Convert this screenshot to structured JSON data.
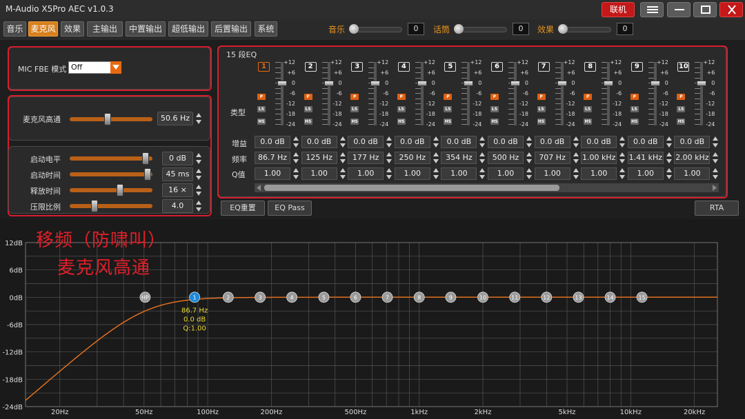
{
  "app": {
    "title": "M-Audio X5Pro AEC  v1.0.3",
    "link_label": "联机"
  },
  "menu": {
    "tabs": [
      {
        "label": "音乐",
        "active": false
      },
      {
        "label": "麦克风",
        "active": true
      },
      {
        "label": "效果",
        "active": false
      },
      {
        "label": "主输出",
        "active": false
      },
      {
        "label": "中置输出",
        "active": false
      },
      {
        "label": "超低输出",
        "active": false
      },
      {
        "label": "后置输出",
        "active": false
      },
      {
        "label": "系统",
        "active": false
      }
    ],
    "mixers": [
      {
        "label": "音乐",
        "value": "0",
        "level": 0
      },
      {
        "label": "话筒",
        "value": "0",
        "level": 0
      },
      {
        "label": "效果",
        "value": "0",
        "level": 0
      }
    ]
  },
  "fbe": {
    "label": "MIC FBE 模式",
    "value": "Off"
  },
  "highpass": {
    "label": "麦克风高通",
    "value": "50.6 Hz",
    "level": 0.45
  },
  "compressor": {
    "rows": [
      {
        "label": "启动电平",
        "value": "0 dB",
        "level": 0.95
      },
      {
        "label": "启动时间",
        "value": "45 ms",
        "level": 0.98
      },
      {
        "label": "释放时间",
        "value": "16 ×",
        "level": 0.62
      },
      {
        "label": "压限比例",
        "value": "4.0",
        "level": 0.28
      }
    ]
  },
  "eq": {
    "title": "15 段EQ",
    "scale_labels": [
      "+12",
      "+6",
      "0",
      "-6",
      "-12",
      "-18",
      "-24"
    ],
    "type_label": "类型",
    "type_buttons": [
      "P",
      "LS",
      "HS"
    ],
    "gain_label": "增益",
    "freq_label": "频率",
    "q_label": "Q值",
    "bands": [
      {
        "num": "1",
        "gain": "0.0 dB",
        "freq": "86.7 Hz",
        "q": "1.00"
      },
      {
        "num": "2",
        "gain": "0.0 dB",
        "freq": "125 Hz",
        "q": "1.00"
      },
      {
        "num": "3",
        "gain": "0.0 dB",
        "freq": "177 Hz",
        "q": "1.00"
      },
      {
        "num": "4",
        "gain": "0.0 dB",
        "freq": "250 Hz",
        "q": "1.00"
      },
      {
        "num": "5",
        "gain": "0.0 dB",
        "freq": "354 Hz",
        "q": "1.00"
      },
      {
        "num": "6",
        "gain": "0.0 dB",
        "freq": "500 Hz",
        "q": "1.00"
      },
      {
        "num": "7",
        "gain": "0.0 dB",
        "freq": "707 Hz",
        "q": "1.00"
      },
      {
        "num": "8",
        "gain": "0.0 dB",
        "freq": "1.00 kHz",
        "q": "1.00"
      },
      {
        "num": "9",
        "gain": "0.0 dB",
        "freq": "1.41 kHz",
        "q": "1.00"
      },
      {
        "num": "10",
        "gain": "0.0 dB",
        "freq": "2.00 kHz",
        "q": "1.00"
      }
    ],
    "reset_label": "EQ重置",
    "pass_label": "EQ Pass",
    "rta_label": "RTA"
  },
  "annotation": {
    "line1": "移频（防啸叫）",
    "line2": "麦克风高通"
  },
  "graph": {
    "y_ticks": [
      {
        "db": 12,
        "label": "12dB"
      },
      {
        "db": 6,
        "label": "6dB"
      },
      {
        "db": 0,
        "label": "0dB"
      },
      {
        "db": -6,
        "label": "-6dB"
      },
      {
        "db": -12,
        "label": "-12dB"
      },
      {
        "db": -18,
        "label": "-18dB"
      },
      {
        "db": -24,
        "label": "-24dB"
      }
    ],
    "x_ticks": [
      {
        "hz": 20,
        "label": "20Hz"
      },
      {
        "hz": 50,
        "label": "50Hz"
      },
      {
        "hz": 100,
        "label": "100Hz"
      },
      {
        "hz": 200,
        "label": "200Hz"
      },
      {
        "hz": 500,
        "label": "500Hz"
      },
      {
        "hz": 1000,
        "label": "1kHz"
      },
      {
        "hz": 2000,
        "label": "2kHz"
      },
      {
        "hz": 5000,
        "label": "5kHz"
      },
      {
        "hz": 10000,
        "label": "10kHz"
      },
      {
        "hz": 20000,
        "label": "20kHz"
      }
    ],
    "nodes": [
      {
        "label": "HP",
        "hz": 50.6,
        "selected": false
      },
      {
        "label": "1",
        "hz": 86.7,
        "selected": true
      },
      {
        "label": "2",
        "hz": 125
      },
      {
        "label": "3",
        "hz": 177
      },
      {
        "label": "4",
        "hz": 250
      },
      {
        "label": "5",
        "hz": 354
      },
      {
        "label": "6",
        "hz": 500
      },
      {
        "label": "7",
        "hz": 707
      },
      {
        "label": "8",
        "hz": 1000
      },
      {
        "label": "9",
        "hz": 1410
      },
      {
        "label": "10",
        "hz": 2000
      },
      {
        "label": "11",
        "hz": 2830
      },
      {
        "label": "12",
        "hz": 4000
      },
      {
        "label": "13",
        "hz": 5660
      },
      {
        "label": "14",
        "hz": 8000
      },
      {
        "label": "15",
        "hz": 11300
      }
    ],
    "selected_info": [
      "86.7 Hz",
      "0.0 dB",
      "Q:1.00"
    ],
    "hp_hz": 50.6,
    "colors": {
      "curve": "#e07020",
      "selected": "#1e88d8",
      "node": "#9a9a9a",
      "info": "#e8d830",
      "grid": "#555555"
    }
  }
}
